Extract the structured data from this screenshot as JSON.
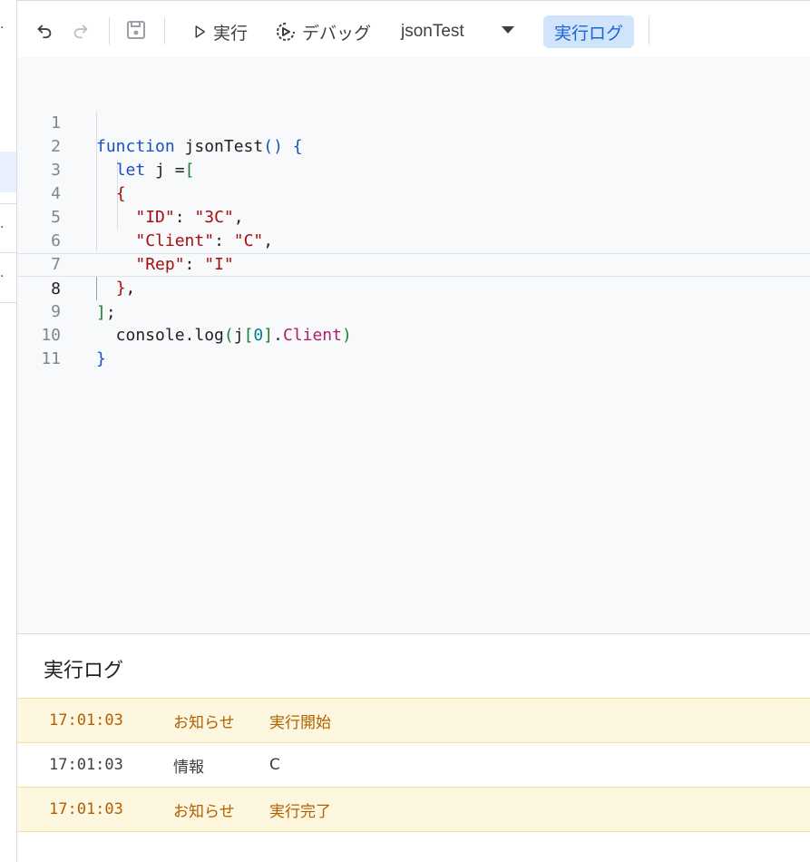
{
  "toolbar": {
    "run_label": "実行",
    "debug_label": "デバッグ",
    "function_name": "jsonTest",
    "log_label": "実行ログ"
  },
  "editor": {
    "active_line": 8,
    "line_numbers": [
      "1",
      "2",
      "3",
      "4",
      "5",
      "6",
      "7",
      "8",
      "9",
      "10",
      "11"
    ]
  },
  "log": {
    "title": "実行ログ",
    "entries": [
      {
        "time": "17:01:03",
        "type": "お知らせ",
        "message": "実行開始"
      },
      {
        "time": "17:01:03",
        "type": "情報",
        "message": "C"
      },
      {
        "time": "17:01:03",
        "type": "お知らせ",
        "message": "実行完了"
      }
    ]
  },
  "colors": {
    "accent": "#1967d2",
    "accent_bg": "#d2e3fc",
    "notice_bg": "#fef7e0",
    "notice_text": "#b06000"
  }
}
